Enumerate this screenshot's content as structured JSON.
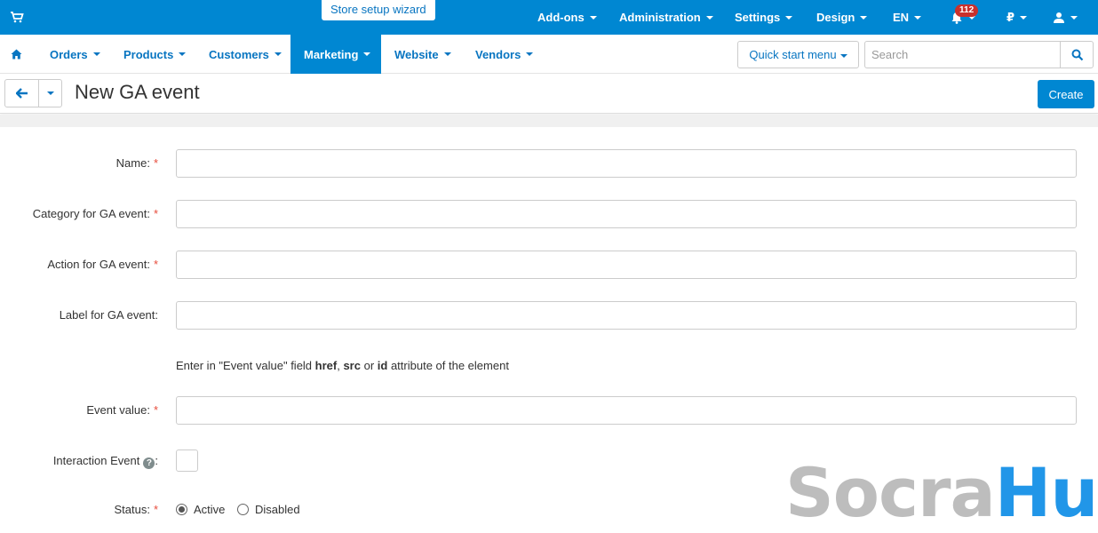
{
  "topbar": {
    "store_setup_wizard": "Store setup wizard",
    "menu": [
      "Add-ons",
      "Administration",
      "Settings",
      "Design",
      "EN"
    ],
    "notifications_count": "112",
    "currency": "₽"
  },
  "nav": {
    "items": [
      "Orders",
      "Products",
      "Customers",
      "Marketing",
      "Website",
      "Vendors"
    ],
    "active": "Marketing",
    "quick_start_label": "Quick start menu",
    "search_placeholder": "Search"
  },
  "page": {
    "title": "New GA event",
    "create_label": "Create"
  },
  "form": {
    "name_label": "Name:",
    "category_label": "Category for GA event:",
    "action_label": "Action for GA event:",
    "label_label": "Label for GA event:",
    "hint": {
      "prefix": "Enter in \"Event value\" field ",
      "href": "href",
      "comma": ", ",
      "src": "src",
      "or": " or ",
      "id": "id",
      "suffix": " attribute of the element"
    },
    "event_value_label": "Event value:",
    "interaction_label": "Interaction Event",
    "interaction_colon": ":",
    "status_label": "Status:",
    "status_options": [
      "Active",
      "Disabled"
    ],
    "status_selected": "Active",
    "required_mark": "*"
  },
  "watermark": {
    "part1": "Socra",
    "part2": "Hub"
  },
  "colors": {
    "primary": "#0087d2",
    "link": "#0875c1",
    "required": "#e74c3c",
    "badge": "#c9302c"
  }
}
